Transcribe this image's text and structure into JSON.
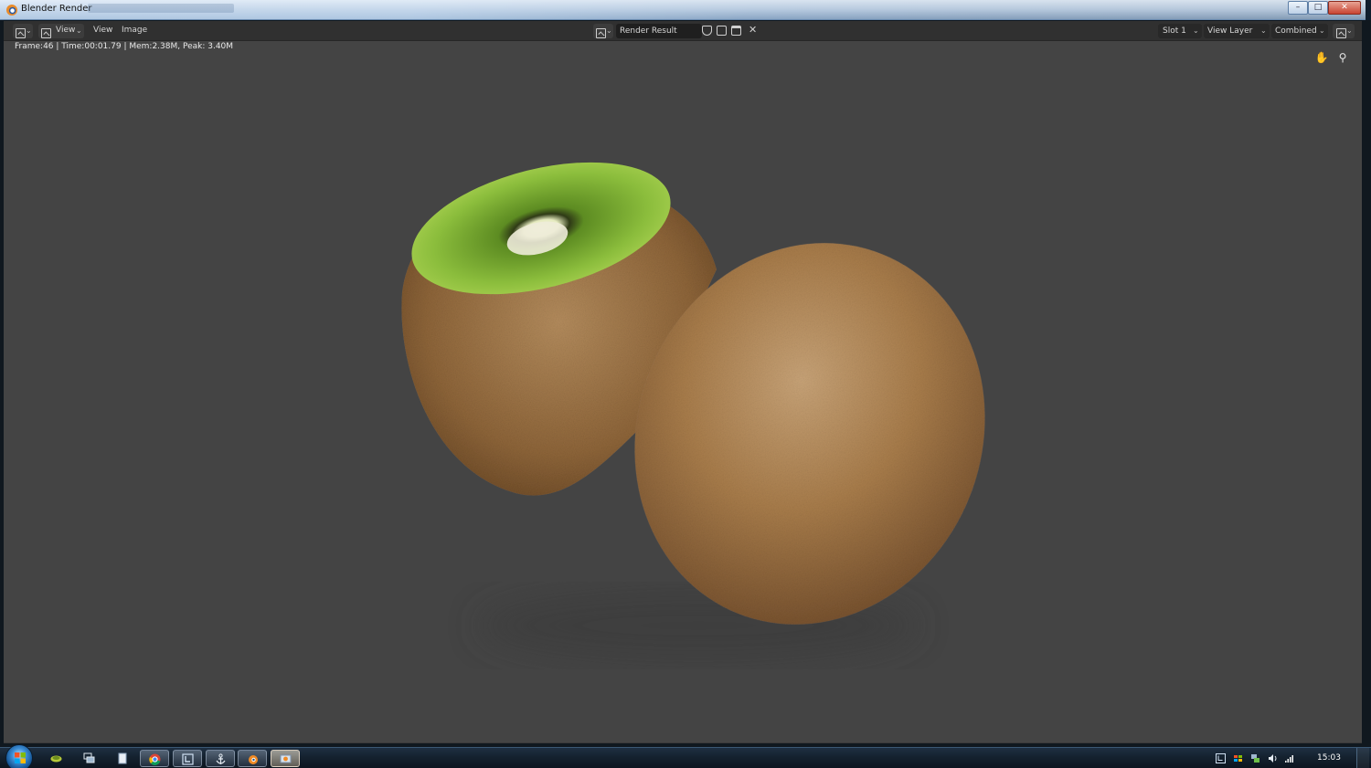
{
  "window": {
    "title": "Blender Render"
  },
  "header": {
    "menu": [
      "View",
      "View",
      "Image"
    ],
    "image_name": "Render Result",
    "slot": "Slot 1",
    "view_layer": "View Layer",
    "pass": "Combined"
  },
  "viewport": {
    "render_info": "Frame:46 | Time:00:01.79 | Mem:2.38M, Peak: 3.40M"
  },
  "taskbar": {
    "clock": "15:03"
  },
  "colors": {
    "viewport_bg": "#444444",
    "header_bg": "#303030",
    "kiwi_skin": "#a57a48",
    "kiwi_flesh": "#7fb23a"
  },
  "icons": {
    "header_left": [
      "image-editor-icon",
      "view-mode-icon"
    ],
    "image_tools": [
      "shield-icon",
      "duplicate-icon",
      "open-folder-icon",
      "close-icon"
    ],
    "gizmos": [
      "hand-pan-icon",
      "zoom-icon"
    ],
    "taskbar_apps": [
      "leaf-app-icon",
      "network-icon",
      "file-icon",
      "chrome-icon",
      "edit-icon",
      "anchor-icon",
      "blender-icon",
      "blender-render-icon"
    ],
    "tray": [
      "tray-app-icon",
      "flag-icon",
      "network-tray-icon",
      "speaker-icon",
      "signal-icon"
    ]
  }
}
